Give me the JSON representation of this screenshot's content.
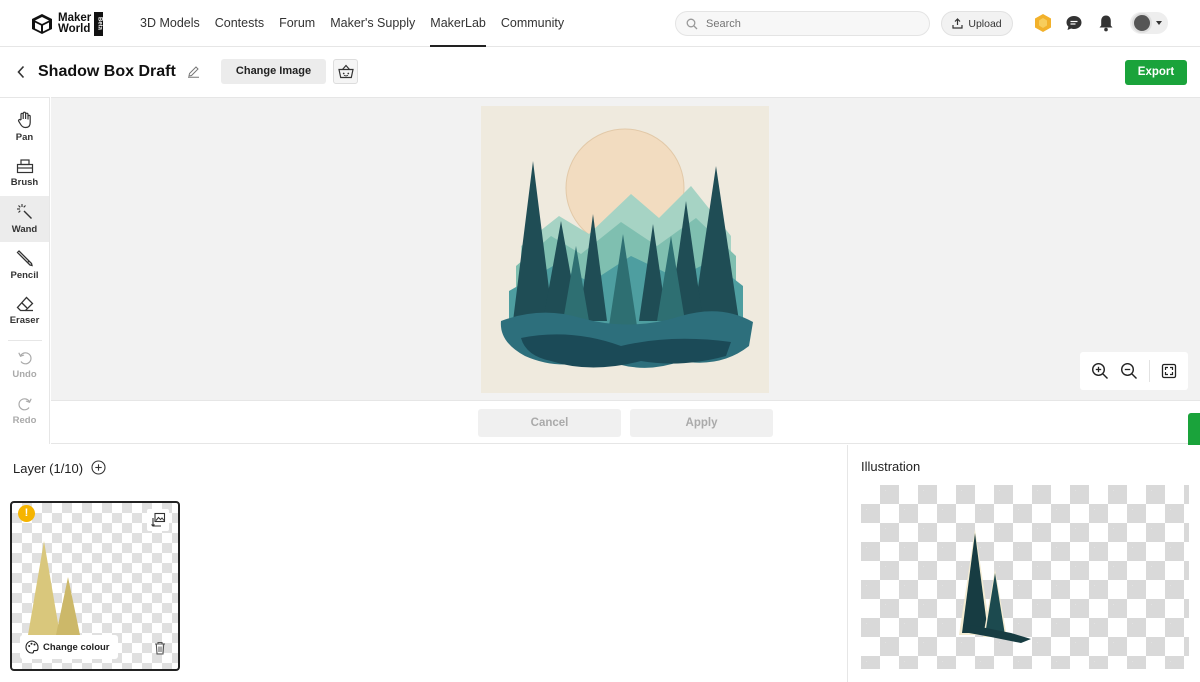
{
  "brand": {
    "line1": "Maker",
    "line2": "World",
    "badge": "Beta"
  },
  "nav": {
    "links": [
      "3D Models",
      "Contests",
      "Forum",
      "Maker's Supply",
      "MakerLab",
      "Community"
    ],
    "active": "MakerLab"
  },
  "search": {
    "placeholder": "Search"
  },
  "header_actions": {
    "upload_label": "Upload"
  },
  "editor": {
    "title": "Shadow Box Draft",
    "change_image_label": "Change Image",
    "export_label": "Export"
  },
  "tools": [
    {
      "label": "Pan",
      "icon": "hand-icon",
      "state": "normal"
    },
    {
      "label": "Brush",
      "icon": "brush-icon",
      "state": "normal"
    },
    {
      "label": "Wand",
      "icon": "magic-wand-icon",
      "state": "active"
    },
    {
      "label": "Pencil",
      "icon": "pencil-icon",
      "state": "normal"
    },
    {
      "label": "Eraser",
      "icon": "eraser-icon",
      "state": "normal"
    },
    {
      "label": "Undo",
      "icon": "undo-icon",
      "state": "disabled"
    },
    {
      "label": "Redo",
      "icon": "redo-icon",
      "state": "disabled"
    }
  ],
  "canvas_actions": {
    "cancel_label": "Cancel",
    "apply_label": "Apply"
  },
  "layers": {
    "title": "Layer (1/10)",
    "warning_glyph": "!",
    "change_colour_label": "Change colour"
  },
  "illustration": {
    "title": "Illustration"
  },
  "colors": {
    "accent_green": "#1aa33b",
    "warning_yellow": "#f5b400",
    "layer_tint": "#d9c77c",
    "tree_dark": "#173c42"
  }
}
